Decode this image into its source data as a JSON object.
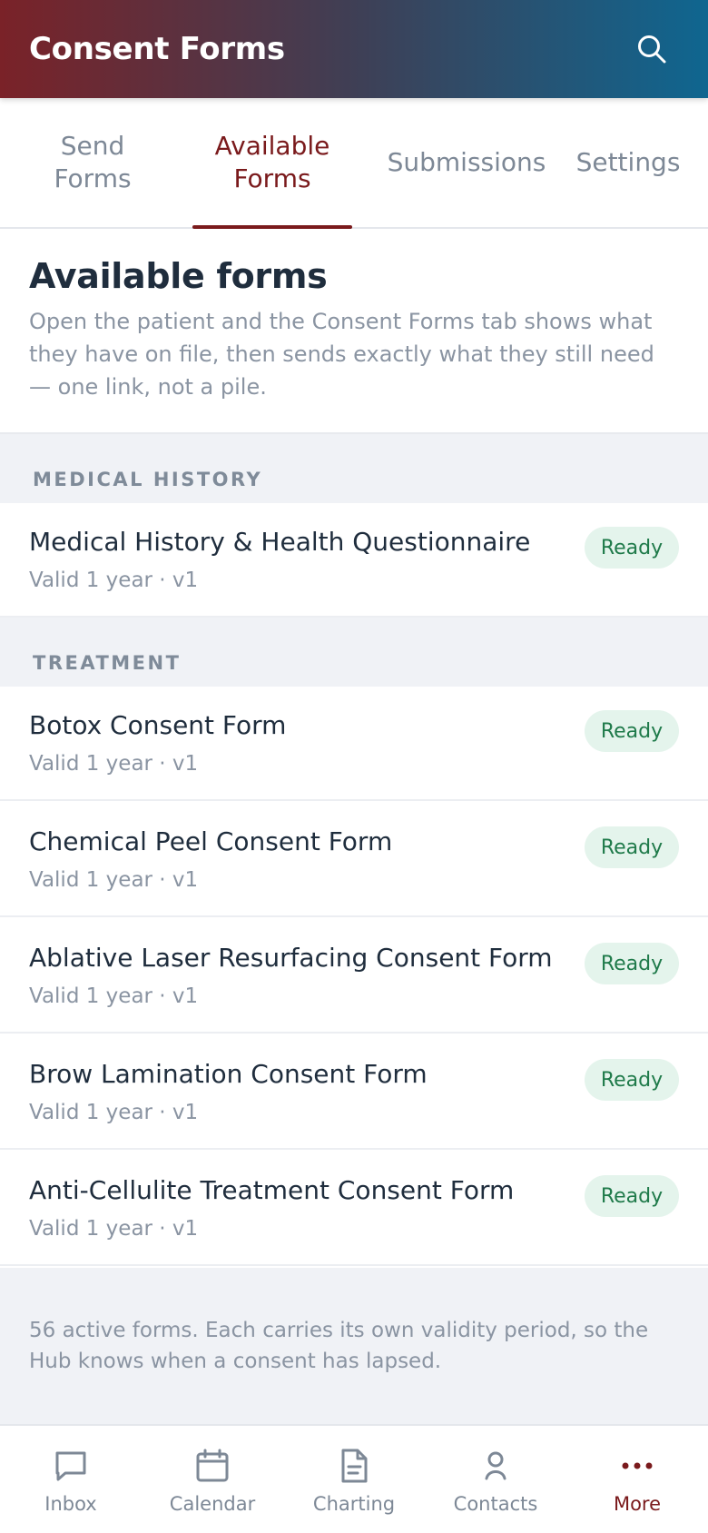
{
  "header": {
    "title": "Consent Forms",
    "search_icon": "search-icon"
  },
  "tabs": [
    {
      "label": "Send\nForms",
      "active": false
    },
    {
      "label": "Available\nForms",
      "active": true
    },
    {
      "label": "Submissions",
      "active": false
    },
    {
      "label": "Settings",
      "active": false
    }
  ],
  "intro": {
    "title": "Available forms",
    "description": "Open the patient and the Consent Forms tab shows what they have on file, then sends exactly what they still need — one link, not a pile."
  },
  "sections": [
    {
      "name": "MEDICAL HISTORY",
      "forms": [
        {
          "title": "Medical History & Health Questionnaire",
          "meta": "Valid 1 year · v1",
          "status": "Ready"
        }
      ]
    },
    {
      "name": "TREATMENT",
      "forms": [
        {
          "title": "Botox Consent Form",
          "meta": "Valid 1 year · v1",
          "status": "Ready"
        },
        {
          "title": "Chemical Peel Consent Form",
          "meta": "Valid 1 year · v1",
          "status": "Ready"
        },
        {
          "title": "Ablative Laser Resurfacing Consent Form",
          "meta": "Valid 1 year · v1",
          "status": "Ready"
        },
        {
          "title": "Brow Lamination Consent Form",
          "meta": "Valid 1 year · v1",
          "status": "Ready"
        },
        {
          "title": "Anti-Cellulite Treatment Consent Form",
          "meta": "Valid 1 year · v1",
          "status": "Ready"
        }
      ]
    }
  ],
  "footer_note": "56 active forms. Each carries its own validity period, so the Hub knows when a consent has lapsed.",
  "bottom_nav": [
    {
      "label": "Inbox",
      "icon": "chat-bubble-icon",
      "active": false
    },
    {
      "label": "Calendar",
      "icon": "calendar-icon",
      "active": false
    },
    {
      "label": "Charting",
      "icon": "document-icon",
      "active": false
    },
    {
      "label": "Contacts",
      "icon": "person-icon",
      "active": false
    },
    {
      "label": "More",
      "icon": "more-dots-icon",
      "active": true
    }
  ],
  "colors": {
    "accent": "#7a1a1c",
    "header_gradient_start": "#7a2228",
    "header_gradient_end": "#0f6690",
    "badge_bg": "#e4f4ec",
    "badge_text": "#1f7a4a"
  }
}
